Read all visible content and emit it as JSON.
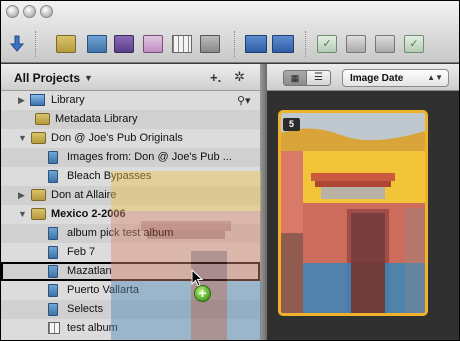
{
  "toolbar": {
    "icons": [
      "import-arrow-icon",
      "new-project-icon",
      "new-book-icon",
      "new-smart-album-icon",
      "new-light-table-icon",
      "new-album-icon",
      "new-web-gallery-icon",
      "stack-icon",
      "compare-icon",
      "approve-icon",
      "rotate-left-icon",
      "rotate-right-icon",
      "check-icon"
    ]
  },
  "sidebar": {
    "title": "All Projects",
    "rows": [
      {
        "label": "Library",
        "type": "library",
        "expander": "right"
      },
      {
        "label": "Metadata Library",
        "type": "project"
      },
      {
        "label": "Don @ Joe's Pub Originals",
        "type": "project",
        "expander": "down"
      },
      {
        "label": "Images from: Don @ Joe's Pub ...",
        "type": "album"
      },
      {
        "label": "Bleach Bypasses",
        "type": "album"
      },
      {
        "label": "Don at Allaire",
        "type": "project",
        "expander": "right"
      },
      {
        "label": "Mexico 2-2006",
        "type": "project",
        "expander": "down",
        "bold": true
      },
      {
        "label": "album pick test album",
        "type": "album"
      },
      {
        "label": "Feb 7",
        "type": "album"
      },
      {
        "label": "Mazatlan",
        "type": "album",
        "selected": true
      },
      {
        "label": "Puerto Vallarta",
        "type": "album"
      },
      {
        "label": "Selects",
        "type": "album"
      },
      {
        "label": "test album",
        "type": "light-table"
      }
    ]
  },
  "browser": {
    "sort_label": "Image Date",
    "badge": "5",
    "drag_plus": "+"
  },
  "colors": {
    "selection": "#f0b12b",
    "sidebar_bg": "#dcdcdc"
  }
}
